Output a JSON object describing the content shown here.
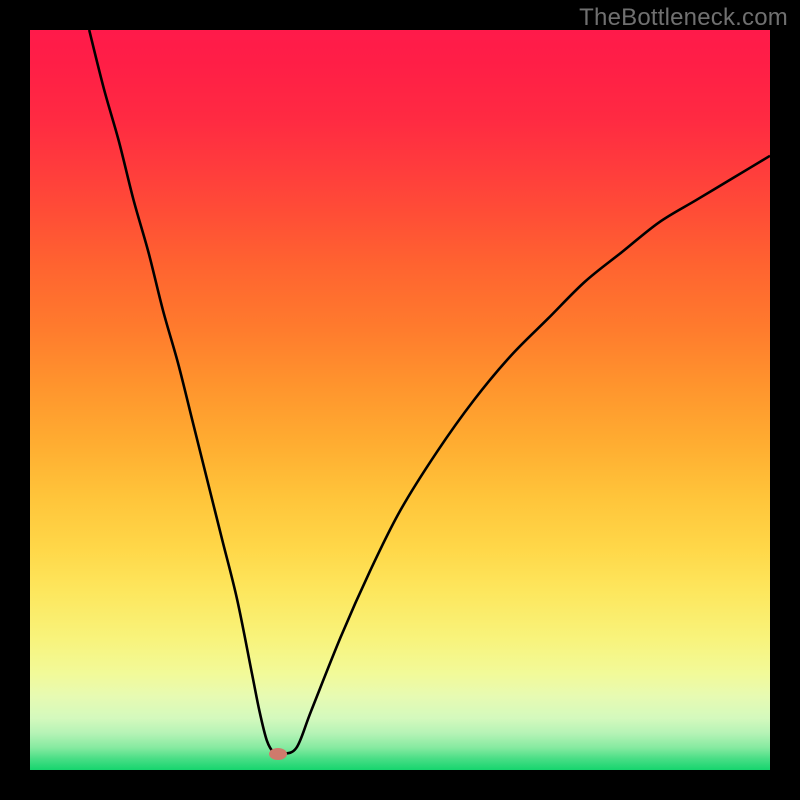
{
  "watermark": "TheBottleneck.com",
  "chart_data": {
    "type": "line",
    "title": "",
    "xlabel": "",
    "ylabel": "",
    "xlim": [
      0,
      100
    ],
    "ylim": [
      0,
      100
    ],
    "series": [
      {
        "name": "bottleneck-curve",
        "x": [
          8,
          10,
          12,
          14,
          16,
          18,
          20,
          22,
          24,
          26,
          28,
          30,
          31,
          32,
          33,
          34,
          36,
          38,
          42,
          46,
          50,
          55,
          60,
          65,
          70,
          75,
          80,
          85,
          90,
          95,
          100
        ],
        "values": [
          100,
          92,
          85,
          77,
          70,
          62,
          55,
          47,
          39,
          31,
          23,
          13,
          8,
          4,
          2.3,
          2.2,
          3,
          8,
          18,
          27,
          35,
          43,
          50,
          56,
          61,
          66,
          70,
          74,
          77,
          80,
          83
        ]
      }
    ],
    "marker": {
      "x": 33.5,
      "y": 2.2
    },
    "grid": false,
    "legend": false
  },
  "colors": {
    "curve": "#000000",
    "marker": "#cf7a6c",
    "frame": "#000000"
  }
}
